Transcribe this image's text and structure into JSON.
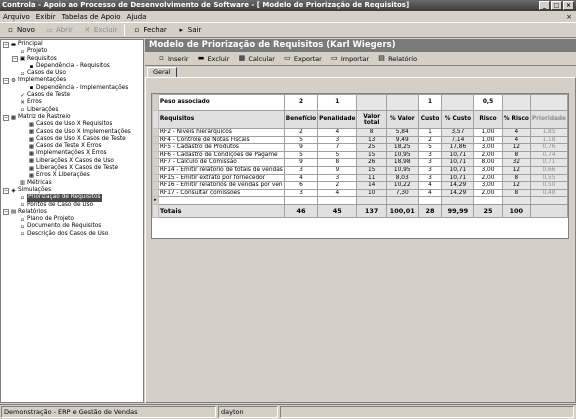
{
  "window": {
    "title": "Controla - Apoio ao Processo de Desenvolvimento de Software - [ Modelo de Priorização de Requisitos]",
    "buttons": [
      "_",
      "□",
      "×"
    ]
  },
  "menu": {
    "items": [
      "Arquivo",
      "Exibir",
      "Tabelas de Apoio",
      "Ajuda"
    ],
    "close": "×"
  },
  "toolbar": {
    "buttons": [
      {
        "label": "Novo",
        "icon": "new-file-icon",
        "glyph": "▫",
        "enabled": true
      },
      {
        "label": "Abrir",
        "icon": "open-folder-icon",
        "glyph": "▭",
        "enabled": false
      },
      {
        "label": "Excluir",
        "icon": "delete-icon",
        "glyph": "✕",
        "enabled": false
      },
      {
        "label": "Fechar",
        "icon": "close-doc-icon",
        "glyph": "▫",
        "enabled": true
      },
      {
        "label": "Sair",
        "icon": "exit-icon",
        "glyph": "▸",
        "enabled": true
      }
    ]
  },
  "tree": [
    {
      "label": "Principal",
      "depth": 0,
      "exp": "−",
      "icon": "folder-icon",
      "glyph": "▬"
    },
    {
      "label": "Projeto",
      "depth": 1,
      "icon": "project-icon",
      "glyph": "▫"
    },
    {
      "label": "Requisitos",
      "depth": 1,
      "exp": "−",
      "icon": "requirements-icon",
      "glyph": "▣"
    },
    {
      "label": "Dependência - Requisitos",
      "depth": 2,
      "icon": "dependency-icon",
      "glyph": "▪"
    },
    {
      "label": "Casos de Uso",
      "depth": 1,
      "icon": "use-case-icon",
      "glyph": "▫"
    },
    {
      "label": "Implementações",
      "depth": 0,
      "exp": "−",
      "icon": "implementation-icon",
      "glyph": "⚙"
    },
    {
      "label": "Dependência - Implementações",
      "depth": 2,
      "icon": "dependency-icon",
      "glyph": "▪"
    },
    {
      "label": "Casos de Teste",
      "depth": 1,
      "icon": "test-case-icon",
      "glyph": "✓"
    },
    {
      "label": "Erros",
      "depth": 1,
      "icon": "error-icon",
      "glyph": "✕"
    },
    {
      "label": "Liberações",
      "depth": 1,
      "icon": "release-icon",
      "glyph": "▫"
    },
    {
      "label": "Matriz de Rastreio",
      "depth": 0,
      "exp": "−",
      "icon": "matrix-icon",
      "glyph": "▦"
    },
    {
      "label": "Casos de Uso X Requisitos",
      "depth": 2,
      "icon": "matrix-item-icon",
      "glyph": "▦"
    },
    {
      "label": "Casos de Uso X Implementações",
      "depth": 2,
      "icon": "matrix-item-icon",
      "glyph": "▦"
    },
    {
      "label": "Casos de Uso X Casos de Teste",
      "depth": 2,
      "icon": "matrix-item-icon",
      "glyph": "▦"
    },
    {
      "label": "Casos de Teste X Erros",
      "depth": 2,
      "icon": "matrix-item-icon",
      "glyph": "▦"
    },
    {
      "label": "Implementações X Erros",
      "depth": 2,
      "icon": "matrix-item-icon",
      "glyph": "▦"
    },
    {
      "label": "Liberações X Casos de Uso",
      "depth": 2,
      "icon": "matrix-item-icon",
      "glyph": "▦"
    },
    {
      "label": "Liberações X Casos de Teste",
      "depth": 2,
      "icon": "matrix-item-icon",
      "glyph": "▦"
    },
    {
      "label": "Erros X Liberações",
      "depth": 2,
      "icon": "matrix-item-icon",
      "glyph": "▦"
    },
    {
      "label": "Métricas",
      "depth": 1,
      "icon": "metrics-icon",
      "glyph": "▥"
    },
    {
      "label": "Simulações",
      "depth": 0,
      "exp": "−",
      "icon": "simulation-icon",
      "glyph": "◈"
    },
    {
      "label": "Priorização de Requisitos",
      "depth": 1,
      "icon": "prioritization-icon",
      "glyph": "▫"
    },
    {
      "label": "Pontos de Caso de Uso",
      "depth": 1,
      "icon": "use-case-points-icon",
      "glyph": "▫"
    },
    {
      "label": "Relatórios",
      "depth": 0,
      "exp": "−",
      "icon": "reports-icon",
      "glyph": "▤"
    },
    {
      "label": "Plano de Projeto",
      "depth": 1,
      "icon": "report-doc-icon",
      "glyph": "▫"
    },
    {
      "label": "Documento de Requisitos",
      "depth": 1,
      "icon": "report-doc-icon",
      "glyph": "▫"
    },
    {
      "label": "Descrição dos Casos de Uso",
      "depth": 1,
      "icon": "report-doc-icon",
      "glyph": "▫"
    }
  ],
  "main": {
    "title": "Modelo de Priorização de Requisitos (Karl Wiegers)",
    "tab": "Geral",
    "toolbar": [
      {
        "label": "Inserir",
        "icon": "insert-icon",
        "glyph": "▫"
      },
      {
        "label": "Excluir",
        "icon": "delete-icon",
        "glyph": "▬"
      },
      {
        "label": "Calcular",
        "icon": "calculate-icon",
        "glyph": "▦"
      },
      {
        "label": "Exportar",
        "icon": "export-icon",
        "glyph": "▭"
      },
      {
        "label": "Importar",
        "icon": "import-icon",
        "glyph": "▭"
      },
      {
        "label": "Relatório",
        "icon": "report-icon",
        "glyph": "▤"
      }
    ]
  },
  "grid": {
    "peso": {
      "label": "Peso associado",
      "beneficio": "2",
      "penalidade": "1",
      "custo": "1",
      "risco": "0,5"
    },
    "headers": [
      "Requisitos",
      "Benefício",
      "Penalidade",
      "Valor total",
      "% Valor",
      "Custo",
      "% Custo",
      "Risco",
      "% Risco",
      "Prioridade"
    ],
    "rows": [
      [
        "RF2 - Níveis hierárquicos",
        "2",
        "4",
        "8",
        "5,84",
        "1",
        "3,57",
        "1,00",
        "4",
        "1,85"
      ],
      [
        "RF4 - Controle de Notas Fiscais",
        "5",
        "3",
        "13",
        "9,49",
        "2",
        "7,14",
        "1,00",
        "4",
        "1,18"
      ],
      [
        "RF5 - Cadastro de Produtos",
        "9",
        "7",
        "25",
        "18,25",
        "5",
        "17,86",
        "3,00",
        "12",
        "0,76"
      ],
      [
        "RF6 - Cadastro de Condições de Pagame",
        "5",
        "5",
        "15",
        "10,95",
        "3",
        "10,71",
        "2,00",
        "8",
        "0,74"
      ],
      [
        "RF7 - Cálculo de Comissão",
        "9",
        "8",
        "26",
        "18,98",
        "3",
        "10,71",
        "8,00",
        "32",
        "0,71"
      ],
      [
        "RF14 - Emitir relatório de totais de vendas",
        "3",
        "9",
        "15",
        "10,95",
        "3",
        "10,71",
        "3,00",
        "12",
        "0,66"
      ],
      [
        "RF15 - Emitir extrato por fornecedor",
        "4",
        "3",
        "11",
        "8,03",
        "3",
        "10,71",
        "2,00",
        "8",
        "0,55"
      ],
      [
        "RF16 - Emitir relatórios de vendas por ven",
        "6",
        "2",
        "14",
        "10,22",
        "4",
        "14,29",
        "3,00",
        "12",
        "0,50"
      ],
      [
        "RF17 - Consultar comissões",
        "3",
        "4",
        "10",
        "7,30",
        "4",
        "14,29",
        "2,00",
        "8",
        "0,48"
      ]
    ],
    "totals": [
      "Totais",
      "46",
      "45",
      "137",
      "100,01",
      "28",
      "99,99",
      "25",
      "100",
      ""
    ]
  },
  "status": {
    "app": "Demonstração - ERP e Gestão de Vendas",
    "user": "dayton"
  }
}
